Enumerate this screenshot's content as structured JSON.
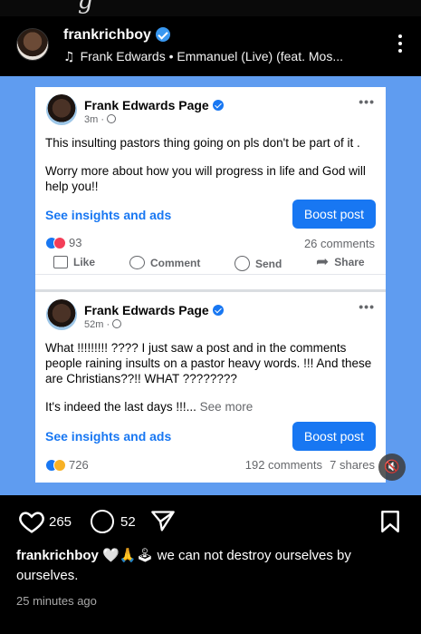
{
  "top_glyph": "g",
  "header": {
    "username": "frankrichboy",
    "music_note_icon": "♫",
    "music": "Frank Edwards • Emmanuel (Live) (feat. Mos..."
  },
  "post1": {
    "page_name": "Frank Edwards Page",
    "time": "3m ·",
    "line1": "This insulting pastors thing going on pls don't be part of it .",
    "line2": "Worry more about how you will progress in life and God will help you!!",
    "insights": "See insights and ads",
    "boost": "Boost post",
    "reactions": "93",
    "comments": "26 comments",
    "actions": {
      "like": "Like",
      "comment": "Comment",
      "send": "Send",
      "share": "Share"
    }
  },
  "post2": {
    "page_name": "Frank Edwards Page",
    "time": "52m ·",
    "line1": "What !!!!!!!!! ???? I just saw a post and in the comments people raining insults on a pastor heavy words. !!! And these are Christians??!! WHAT ????????",
    "line2": "It's indeed the last days !!!...",
    "see_more": " See more",
    "insights": "See insights and ads",
    "boost": "Boost post",
    "reactions": "726",
    "comments": "192 comments",
    "shares": "7 shares"
  },
  "mute_icon": "🔇",
  "toolbar": {
    "likes": "265",
    "comments": "52"
  },
  "caption": {
    "username": "frankrichboy",
    "emojis": "🤍🙏🕹",
    "text": " we can not destroy ourselves by ourselves."
  },
  "timestamp": "25 minutes ago",
  "colors": {
    "accent": "#1877f2",
    "media_bg": "#5f9cf0",
    "ig_verified": "#3897f0"
  }
}
